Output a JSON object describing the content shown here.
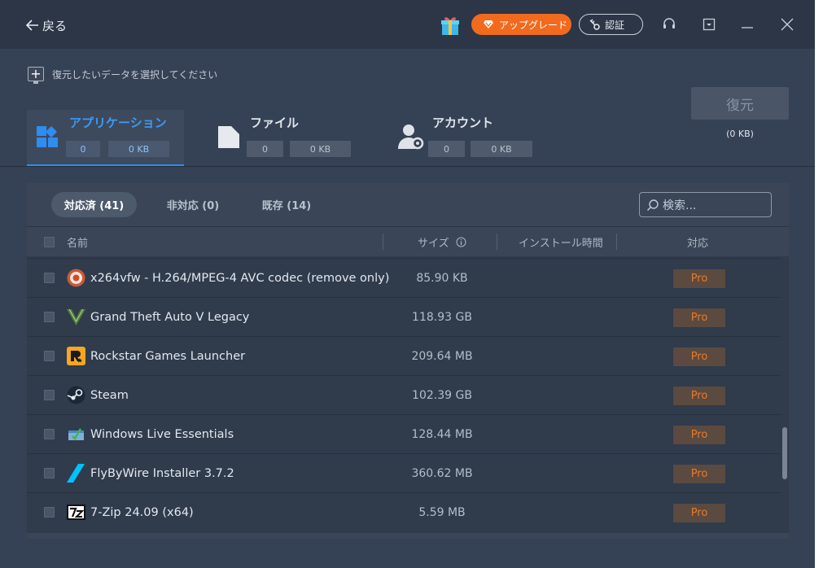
{
  "titlebar": {
    "back_label": "戻る",
    "upgrade_label": "アップグレード",
    "auth_label": "認証"
  },
  "header": {
    "select_hint": "復元したいデータを選択してください",
    "categories": [
      {
        "title": "アプリケーション",
        "count": "0",
        "size": "0 KB"
      },
      {
        "title": "ファイル",
        "count": "0",
        "size": "0 KB"
      },
      {
        "title": "アカウント",
        "count": "0",
        "size": "0 KB"
      }
    ],
    "restore_label": "復元",
    "restore_size": "(0 KB)"
  },
  "filters": {
    "tabs": [
      {
        "label": "対応済 (41)"
      },
      {
        "label": "非対応 (0)"
      },
      {
        "label": "既存 (14)"
      }
    ],
    "search_placeholder": "検索..."
  },
  "table": {
    "columns": {
      "name": "名前",
      "size": "サイズ",
      "install_time": "インストール時間",
      "support": "対応"
    },
    "rows": [
      {
        "name": "x264vfw - H.264/MPEG-4 AVC codec (remove only)",
        "size": "85.90 KB",
        "badge": "Pro",
        "icon": "x264-icon"
      },
      {
        "name": "Grand Theft Auto V Legacy",
        "size": "118.93 GB",
        "badge": "Pro",
        "icon": "gta-v-icon"
      },
      {
        "name": "Rockstar Games Launcher",
        "size": "209.64 MB",
        "badge": "Pro",
        "icon": "rockstar-icon"
      },
      {
        "name": "Steam",
        "size": "102.39 GB",
        "badge": "Pro",
        "icon": "steam-icon"
      },
      {
        "name": "Windows Live Essentials",
        "size": "128.44 MB",
        "badge": "Pro",
        "icon": "windows-live-icon"
      },
      {
        "name": "FlyByWire Installer 3.7.2",
        "size": "360.62 MB",
        "badge": "Pro",
        "icon": "flybywire-icon"
      },
      {
        "name": "7-Zip 24.09 (x64)",
        "size": "5.59 MB",
        "badge": "Pro",
        "icon": "7zip-icon"
      }
    ]
  },
  "colors": {
    "accent_blue": "#2f8cf0",
    "upgrade_orange": "#f26a1d",
    "pro_text": "#e77a2a"
  }
}
